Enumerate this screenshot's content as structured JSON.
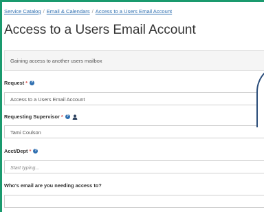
{
  "breadcrumb": {
    "items": [
      "Service Catalog",
      "Email & Calendars",
      "Access to a Users Email Account"
    ],
    "separator": "/"
  },
  "page": {
    "title": "Access to a Users Email Account",
    "description": "Gaining access to another users mailbox"
  },
  "form": {
    "request": {
      "label": "Request",
      "required": "*",
      "value": "Access to a Users Email Account"
    },
    "supervisor": {
      "label": "Requesting Supervisor",
      "required": "*",
      "value": "Tami Coulson"
    },
    "acct_dept": {
      "label": "Acct/Dept",
      "required": "*",
      "placeholder": "Start typing..."
    },
    "whos_email": {
      "label": "Who's email are you needing access to?",
      "value": ""
    }
  },
  "icons": {
    "help": "question-circle-icon",
    "user": "user-icon"
  },
  "colors": {
    "frame": "#1a9a6e",
    "link": "#2f6fb0",
    "required": "#d9534f",
    "popup_border": "#2a4d7a"
  }
}
